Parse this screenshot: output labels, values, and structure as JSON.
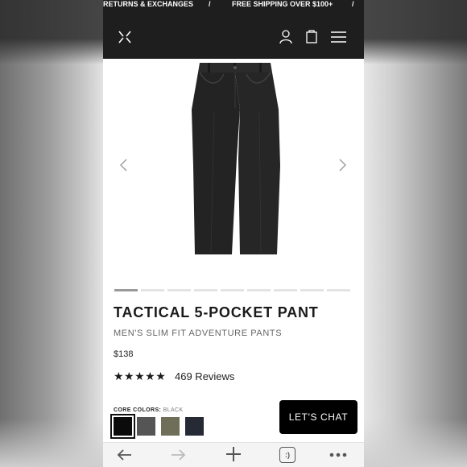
{
  "promo": {
    "left_text": "RETURNS & EXCHANGES",
    "sep1": "/",
    "right_text": "FREE SHIPPING OVER $100+",
    "sep2": "/"
  },
  "header": {
    "logo_icon": "x-logo-icon",
    "account_icon": "user-icon",
    "cart_icon": "shopping-bag-icon",
    "menu_icon": "hamburger-menu-icon"
  },
  "product": {
    "title": "TACTICAL 5-POCKET PANT",
    "subtitle": "MEN'S SLIM FIT ADVENTURE PANTS",
    "price": "$138",
    "stars": "★★★★★",
    "rating_stars": 5,
    "reviews": "469 Reviews",
    "image_icon": "black-pants-image",
    "gallery_count": 9,
    "gallery_active_index": 0
  },
  "colors": {
    "label": "CORE COLORS:",
    "selected": "BLACK",
    "swatches": [
      {
        "name": "black",
        "hex": "#0b0b0b"
      },
      {
        "name": "charcoal",
        "hex": "#555555"
      },
      {
        "name": "olive",
        "hex": "#6f6e58"
      },
      {
        "name": "navy",
        "hex": "#252a35"
      }
    ]
  },
  "chat": {
    "label": "LET'S CHAT"
  },
  "browser": {
    "back_icon": "arrow-left-icon",
    "forward_icon": "arrow-right-icon",
    "new_tab_icon": "plus-icon",
    "tabs_label": ":)",
    "more_icon": "more-dots-icon"
  },
  "theme": {
    "header_bg": "#1e1e1e",
    "accent": "#000000"
  }
}
